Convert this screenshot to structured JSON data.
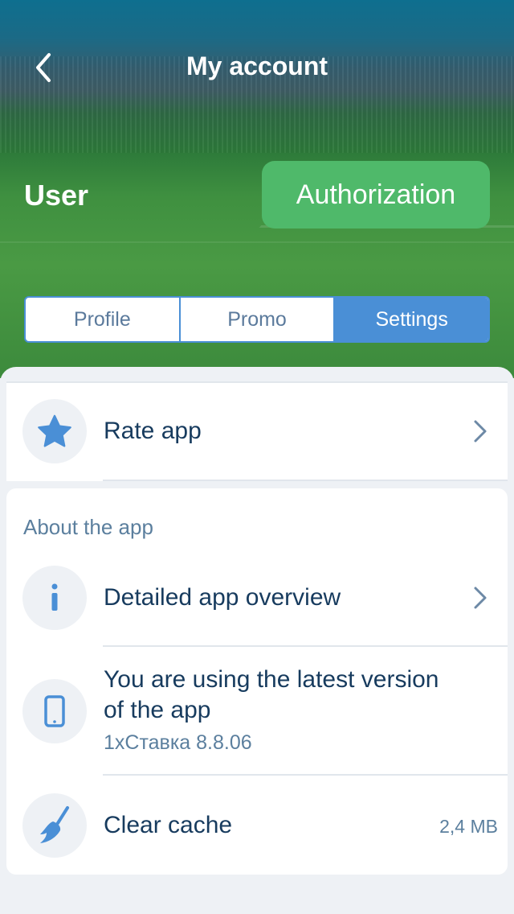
{
  "header": {
    "title": "My account",
    "back_icon": "chevron-left-icon"
  },
  "user": {
    "label": "User",
    "auth_button": "Authorization"
  },
  "tabs": [
    {
      "label": "Profile",
      "active": false
    },
    {
      "label": "Promo",
      "active": false
    },
    {
      "label": "Settings",
      "active": true
    }
  ],
  "rate": {
    "label": "Rate app",
    "icon": "star-icon"
  },
  "about": {
    "section_title": "About the app",
    "overview_label": "Detailed app overview",
    "version_line1": "You are using the latest version",
    "version_line2": "of the app",
    "version_sub": "1xСтавка 8.8.06",
    "cache_label": "Clear cache",
    "cache_size": "2,4 MB"
  },
  "colors": {
    "accent": "#4a8fd6",
    "auth_green": "#4fb96a",
    "text_dark": "#173b5e",
    "text_muted": "#5b7f9e"
  }
}
